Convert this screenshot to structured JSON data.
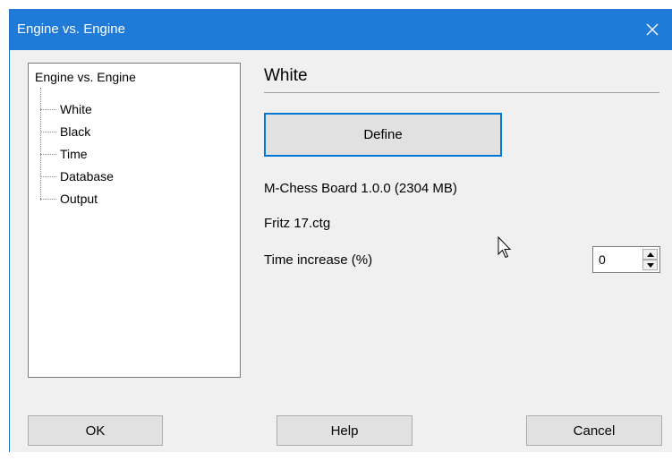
{
  "window": {
    "title": "Engine vs. Engine"
  },
  "tree": {
    "root": "Engine vs. Engine",
    "items": [
      {
        "label": "White",
        "selected": true
      },
      {
        "label": "Black",
        "selected": false
      },
      {
        "label": "Time",
        "selected": false
      },
      {
        "label": "Database",
        "selected": false
      },
      {
        "label": "Output",
        "selected": false
      }
    ]
  },
  "panel": {
    "heading": "White",
    "define_label": "Define",
    "engine_text": "M-Chess Board 1.0.0  (2304 MB)",
    "book_text": "Fritz 17.ctg",
    "time_increase_label": "Time increase (%)",
    "time_increase_value": "0"
  },
  "buttons": {
    "ok": "OK",
    "help": "Help",
    "cancel": "Cancel"
  },
  "icons": {
    "close": "close-icon",
    "spin_up": "arrow-up-icon",
    "spin_down": "arrow-down-icon",
    "cursor": "mouse-pointer-icon"
  },
  "colors": {
    "titlebar": "#1f7ad8",
    "focus_border": "#0078d7",
    "dialog_background": "#f0f0f0"
  }
}
